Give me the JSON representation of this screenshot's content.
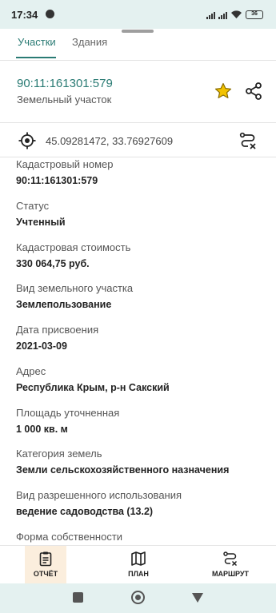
{
  "status_bar": {
    "time": "17:34",
    "battery": "36"
  },
  "tabs": [
    {
      "label": "Участки",
      "active": true
    },
    {
      "label": "Здания",
      "active": false
    }
  ],
  "parcel": {
    "number": "90:11:161301:579",
    "type": "Земельный участок"
  },
  "coordinates": "45.09281472, 33.76927609",
  "fields": [
    {
      "label": "Кадастровый номер",
      "value": "90:11:161301:579"
    },
    {
      "label": "Статус",
      "value": "Учтенный"
    },
    {
      "label": "Кадастровая стоимость",
      "value": "330 064,75 руб."
    },
    {
      "label": "Вид земельного участка",
      "value": "Землепользование"
    },
    {
      "label": "Дата присвоения",
      "value": "2021-03-09"
    },
    {
      "label": "Адрес",
      "value": "Республика Крым, р-н Сакский"
    },
    {
      "label": "Площадь уточненная",
      "value": "1 000 кв. м"
    },
    {
      "label": "Категория земель",
      "value": "Земли сельскохозяйственного назначения"
    },
    {
      "label": "Вид разрешенного использования",
      "value": "ведение садоводства (13.2)"
    },
    {
      "label": "Форма собственности",
      "value": ""
    }
  ],
  "bottom_bar": {
    "report_label": "ОТЧЁТ",
    "plan_label": "ПЛАН",
    "route_label": "МАРШРУТ"
  },
  "colors": {
    "accent": "#2a7b74",
    "favorite_star": "#f2c200",
    "status_bar_bg": "#e4f1f0",
    "report_button_bg": "#fbeedd"
  },
  "icons": {
    "favorite": "star-icon",
    "share": "share-icon",
    "location": "target-icon",
    "route": "route-icon",
    "report": "clipboard-icon",
    "plan": "map-icon"
  }
}
